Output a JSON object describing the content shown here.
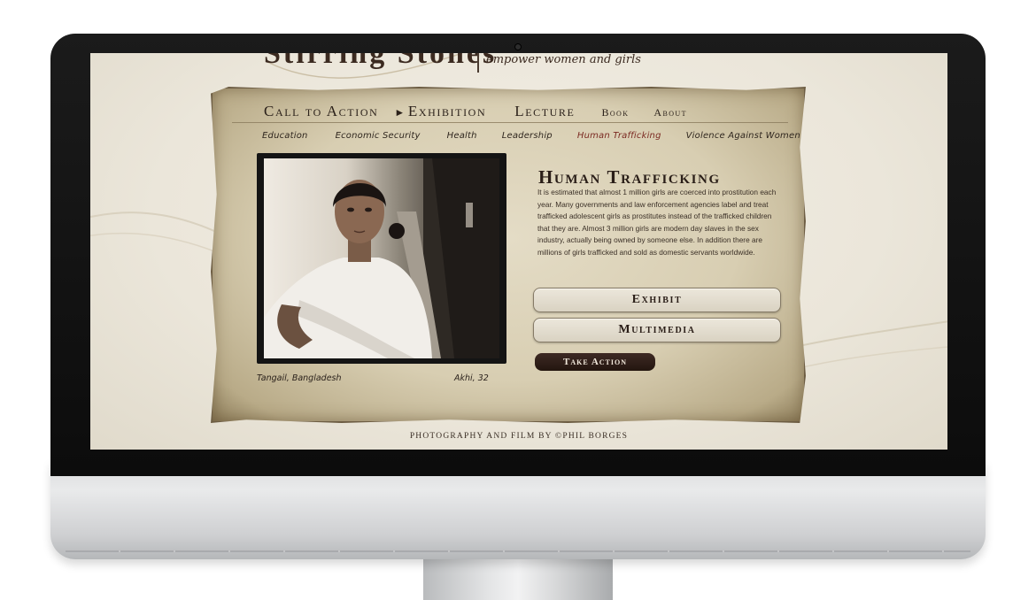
{
  "site": {
    "logo_text": "Stirring Stones",
    "tagline": "empower women and girls"
  },
  "nav_main": {
    "items": [
      {
        "label": "Call to Action"
      },
      {
        "label": "Exhibition",
        "active_marker": "►"
      },
      {
        "label": "Lecture"
      },
      {
        "label": "Book"
      },
      {
        "label": "About"
      }
    ]
  },
  "nav_sub": {
    "items": [
      {
        "label": "Education"
      },
      {
        "label": "Economic Security"
      },
      {
        "label": "Health"
      },
      {
        "label": "Leadership"
      },
      {
        "label": "Human Trafficking",
        "active": true
      },
      {
        "label": "Violence Against Women"
      }
    ]
  },
  "photo": {
    "caption_location": "Tangail, Bangladesh",
    "caption_subject": "Akhi, 32"
  },
  "content": {
    "title": "Human Trafficking",
    "body": "It is estimated that almost 1 million girls are coerced into prostitution each year. Many governments and law enforcement agencies label and treat trafficked adolescent girls as prostitutes instead of the trafficked children that they are. Almost 3 million girls are modern day slaves in the sex industry, actually being owned by someone else. In addition there are millions of girls trafficked and sold as domestic servants worldwide.",
    "exhibit_button": "Exhibit",
    "multimedia_button": "Multimedia",
    "take_action_button": "Take Action"
  },
  "footer": {
    "credit": "PHOTOGRAPHY AND FILM BY ©PHIL BORGES"
  },
  "colors": {
    "parchment": "#d8ceb2",
    "active_link": "#7b2a22",
    "dark_text": "#2a1e18",
    "take_action_bg": "#2f1f18"
  }
}
